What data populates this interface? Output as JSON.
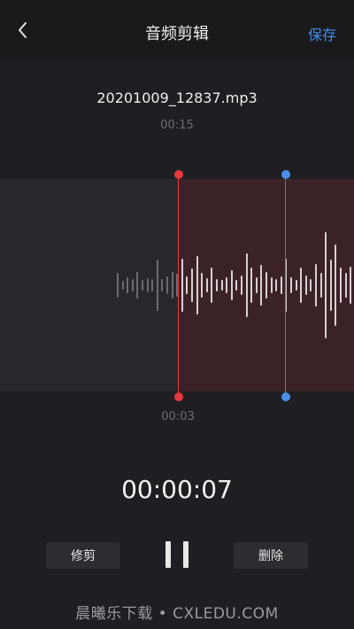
{
  "nav": {
    "title": "音频剪辑",
    "save_label": "保存",
    "back_icon": "chevron-left-icon"
  },
  "file": {
    "name": "20201009_12837.mp3",
    "duration": "00:15"
  },
  "trim": {
    "start_time": "00:03",
    "start_fraction": 0.2,
    "end_fraction": 0.4667
  },
  "player": {
    "current_time": "00:00:07"
  },
  "actions": {
    "trim_label": "修剪",
    "delete_label": "删除",
    "pause_icon": "pause-icon"
  },
  "watermark": {
    "text": "晨曦乐下载 • CXLEDU.COM"
  },
  "colors": {
    "accent": "#3d8ef0",
    "start_handle": "#e8383d",
    "end_handle": "#4f76e0",
    "selection": "#3a2226"
  }
}
